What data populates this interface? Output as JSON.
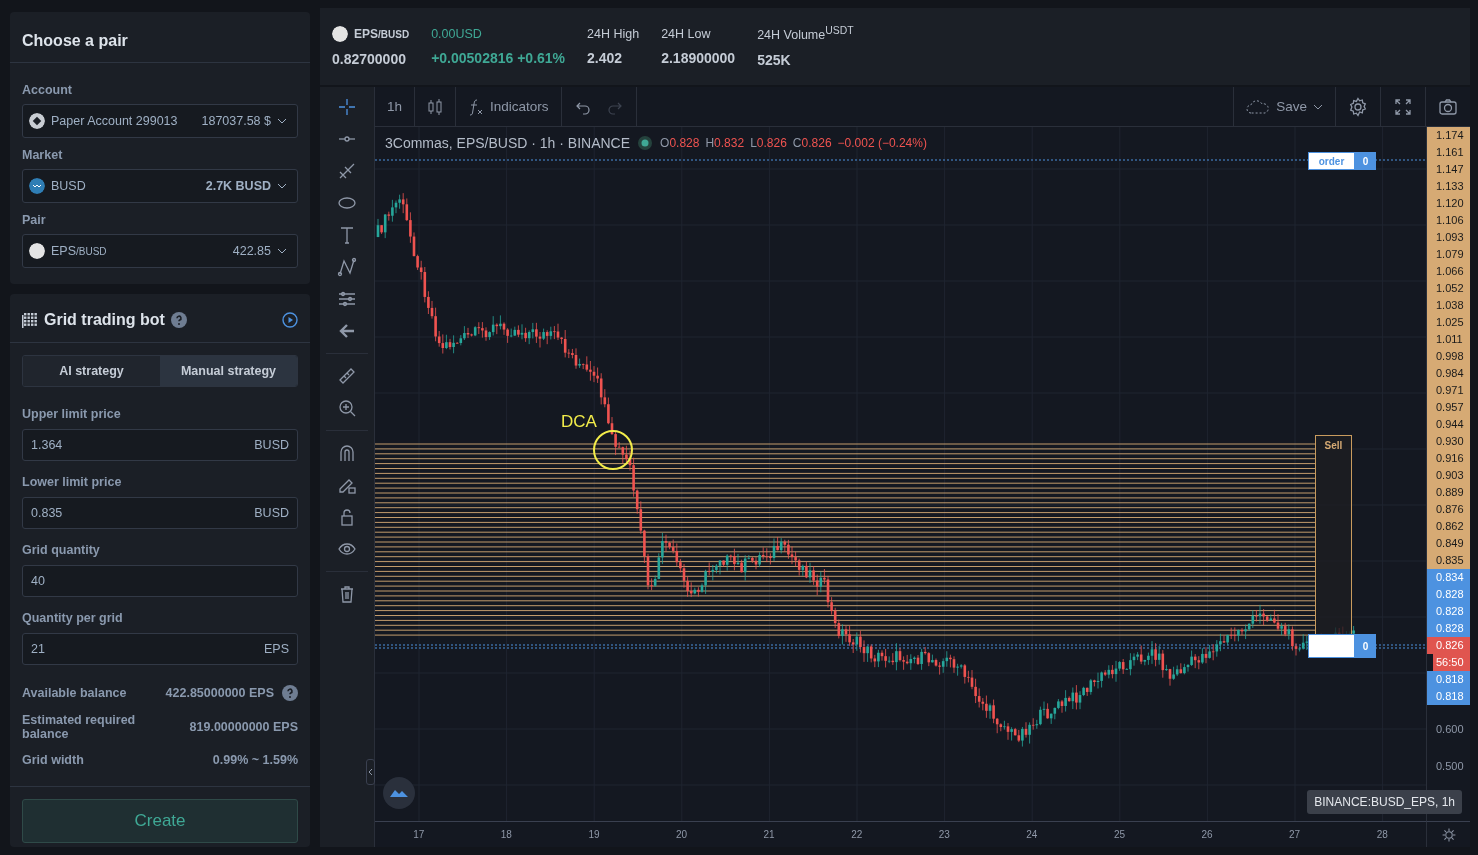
{
  "header": {
    "pair": {
      "base": "EPS",
      "quote": "/BUSD"
    },
    "price": "0.82700000",
    "change_usd": "0.00USD",
    "change": "+0.00502816 +0.61%",
    "stats": [
      {
        "label": "24H High",
        "value": "2.402"
      },
      {
        "label": "24H Low",
        "value": "2.18900000"
      },
      {
        "label": "24H Volume$^{USDT}$",
        "value": "525K"
      }
    ]
  },
  "choose_pair": {
    "title": "Choose a pair",
    "selects": [
      {
        "kind": "account",
        "label": "Account",
        "value": "Paper Account 299013",
        "amount": "187037.58 $"
      },
      {
        "kind": "market",
        "label": "Market",
        "value": "BUSD",
        "amount": "2.7K BUSD"
      },
      {
        "kind": "pair",
        "label": "Pair",
        "value": "EPS",
        "quote": "/BUSD",
        "amount": "422.85"
      }
    ]
  },
  "bot": {
    "title": "Grid trading bot",
    "tabs": [
      {
        "label": "AI strategy",
        "selected": false
      },
      {
        "label": "Manual strategy",
        "selected": true
      }
    ],
    "fields": [
      {
        "label": "Upper limit price",
        "value": "1.364",
        "unit": "BUSD"
      },
      {
        "label": "Lower limit price",
        "value": "0.835",
        "unit": "BUSD"
      },
      {
        "label": "Grid quantity",
        "value": "40"
      },
      {
        "label": "Quantity per grid",
        "value": "21",
        "unit": "EPS"
      }
    ],
    "info": [
      {
        "label": "Available balance",
        "value": "422.85000000 EPS",
        "help": true
      },
      {
        "label": "Estimated required balance",
        "value": "819.00000000 EPS",
        "help": false
      },
      {
        "label": "Grid width",
        "value": "0.99% ~ 1.59%",
        "help": false
      }
    ],
    "create_button": "Create"
  },
  "chart": {
    "timeframe": "1h",
    "indicators_label": "Indicators",
    "save_label": "Save",
    "history": [
      {
        "kind": "undo",
        "disabled": false
      },
      {
        "kind": "redo",
        "disabled": true
      }
    ],
    "title": "3Commas, EPS/BUSD · 1h · BINANCE",
    "ohlc": [
      {
        "label": "O",
        "value": "0.828"
      },
      {
        "label": "H",
        "value": "0.832"
      },
      {
        "label": "L",
        "value": "0.826"
      },
      {
        "label": "C",
        "value": "0.826"
      }
    ],
    "change": "−0.002 (−0.24%)",
    "annotation": "DCA",
    "sell_label": "Sell",
    "order_label": "order",
    "order_count": "0",
    "position_count": "0",
    "price_axis": [
      {
        "text": "1.174",
        "kind": "sell"
      },
      {
        "text": "1.161",
        "kind": "sell"
      },
      {
        "text": "1.147",
        "kind": "sell"
      },
      {
        "text": "1.133",
        "kind": "sell"
      },
      {
        "text": "1.120",
        "kind": "sell"
      },
      {
        "text": "1.106",
        "kind": "sell"
      },
      {
        "text": "1.093",
        "kind": "sell"
      },
      {
        "text": "1.079",
        "kind": "sell"
      },
      {
        "text": "1.066",
        "kind": "sell"
      },
      {
        "text": "1.052",
        "kind": "sell"
      },
      {
        "text": "1.038",
        "kind": "sell"
      },
      {
        "text": "1.025",
        "kind": "sell"
      },
      {
        "text": "1.011",
        "kind": "sell"
      },
      {
        "text": "0.998",
        "kind": "sell"
      },
      {
        "text": "0.984",
        "kind": "sell"
      },
      {
        "text": "0.971",
        "kind": "sell"
      },
      {
        "text": "0.957",
        "kind": "sell"
      },
      {
        "text": "0.944",
        "kind": "sell"
      },
      {
        "text": "0.930",
        "kind": "sell"
      },
      {
        "text": "0.916",
        "kind": "sell"
      },
      {
        "text": "0.903",
        "kind": "sell"
      },
      {
        "text": "0.889",
        "kind": "sell"
      },
      {
        "text": "0.876",
        "kind": "sell"
      },
      {
        "text": "0.862",
        "kind": "sell"
      },
      {
        "text": "0.849",
        "kind": "sell"
      },
      {
        "text": "0.835",
        "kind": "sell"
      },
      {
        "text": "0.834",
        "kind": "buy"
      },
      {
        "text": "0.828",
        "kind": "buy"
      },
      {
        "text": "0.828",
        "kind": "buy"
      },
      {
        "text": "0.828",
        "kind": "buy"
      },
      {
        "text": "0.826",
        "kind": "last"
      },
      {
        "text": "56:50",
        "kind": "timer"
      },
      {
        "text": "0.818",
        "kind": "buy"
      },
      {
        "text": "0.818",
        "kind": "buy"
      },
      {
        "text": "0.600",
        "kind": "plain"
      },
      {
        "text": "0.500",
        "kind": "plain"
      }
    ],
    "dates": [
      "17",
      "18",
      "19",
      "20",
      "21",
      "22",
      "23",
      "24",
      "25",
      "26",
      "27",
      "28"
    ],
    "tooltip": "BINANCE:BUSD_EPS, 1h"
  }
}
